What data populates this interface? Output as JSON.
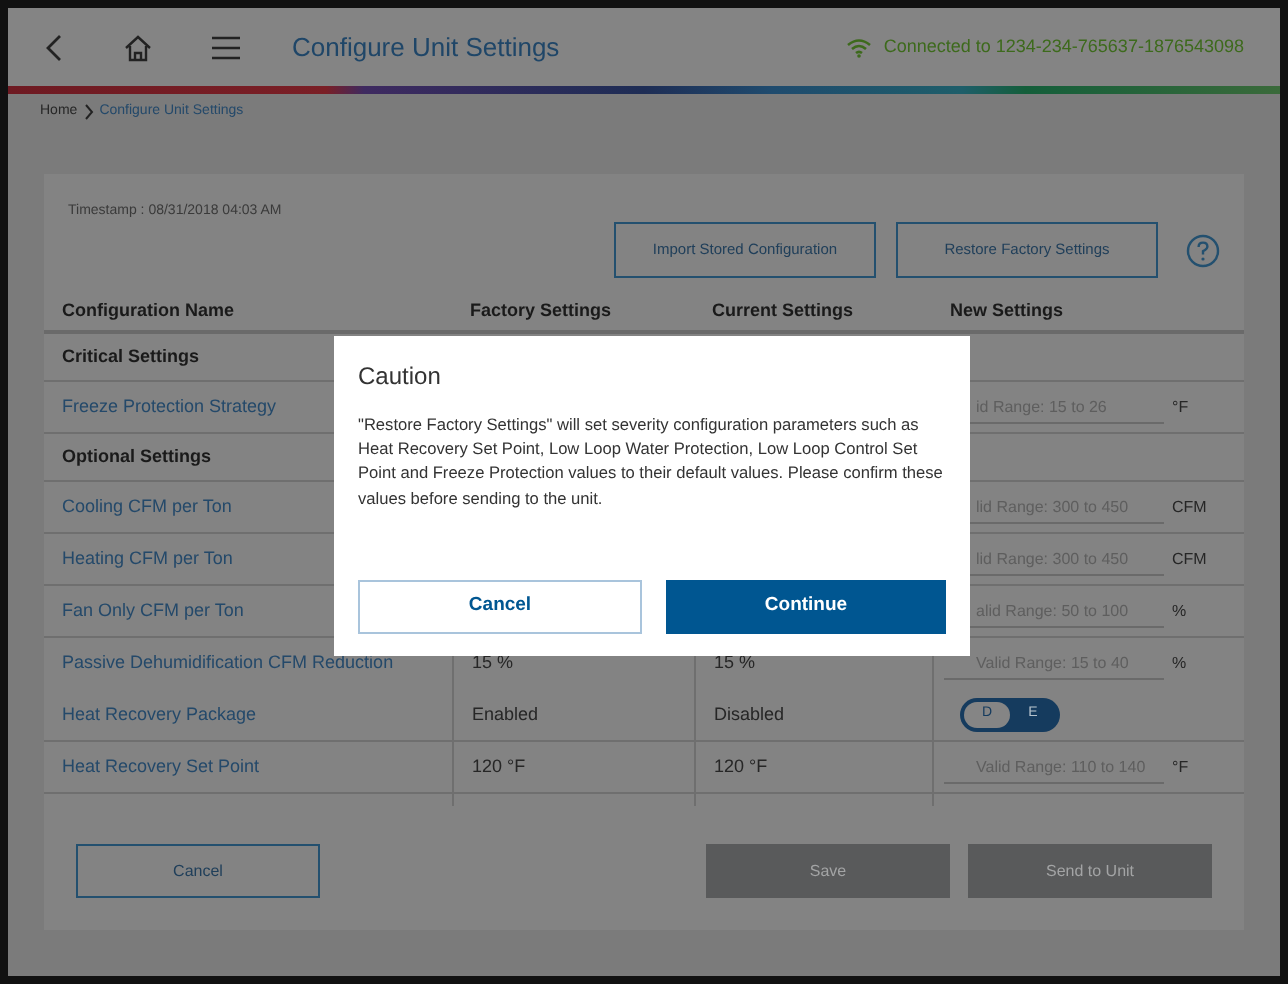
{
  "header": {
    "title": "Configure Unit Settings",
    "connection": "Connected to 1234-234-765637-1876543098"
  },
  "breadcrumb": [
    "Home",
    "Configure Unit Settings"
  ],
  "timestamp": "Timestamp : 08/31/2018 04:03 AM",
  "actions": [
    "Import Stored Configuration",
    "Restore Factory Settings"
  ],
  "table": {
    "columns": [
      "Configuration Name",
      "Factory Settings",
      "Current Settings",
      "New Settings"
    ],
    "rows": [
      {
        "kind": "section",
        "name": "Critical Settings"
      },
      {
        "kind": "input",
        "name": "Freeze Protection Strategy",
        "placeholder": "id Range: 15 to 26",
        "unit": "°F"
      },
      {
        "kind": "section",
        "name": "Optional Settings"
      },
      {
        "kind": "input",
        "name": "Cooling CFM per Ton",
        "placeholder": "lid Range: 300 to 450",
        "unit": "CFM"
      },
      {
        "kind": "input",
        "name": "Heating CFM per Ton",
        "placeholder": "lid Range: 300 to 450",
        "unit": "CFM"
      },
      {
        "kind": "input",
        "name": "Fan Only CFM per Ton",
        "placeholder": "alid Range: 50 to 100",
        "unit": "%"
      },
      {
        "kind": "input",
        "name": "Passive Dehumidification CFM Reduction",
        "factory": "15 %",
        "current": "15 %",
        "placeholder": "Valid Range: 15 to 40",
        "unit": "%"
      },
      {
        "kind": "toggle",
        "name": "Heat Recovery Package",
        "factory": "Enabled",
        "current": "Disabled",
        "options": [
          {
            "label": "D",
            "selected": true
          },
          {
            "label": "E",
            "selected": false
          }
        ]
      },
      {
        "kind": "input",
        "name": "Heat Recovery Set Point",
        "factory": "120 °F",
        "current": "120 °F",
        "placeholder": "Valid Range: 110 to 140",
        "unit": "°F"
      }
    ]
  },
  "footer": {
    "cancel": "Cancel",
    "save": "Save",
    "send": "Send to Unit",
    "save_disabled": true,
    "send_disabled": true
  },
  "dialog": {
    "title": "Caution",
    "message": "\"Restore Factory Settings\" will set severity configuration parameters such as Heat Recovery Set Point, Low Loop Water Protection, Low Loop Control Set Point and Freeze Protection values to their default values. Please confirm these values before sending to the unit.",
    "buttons": [
      {
        "kind": "secondary",
        "label": "Cancel"
      },
      {
        "kind": "primary",
        "label": "Continue"
      }
    ]
  }
}
